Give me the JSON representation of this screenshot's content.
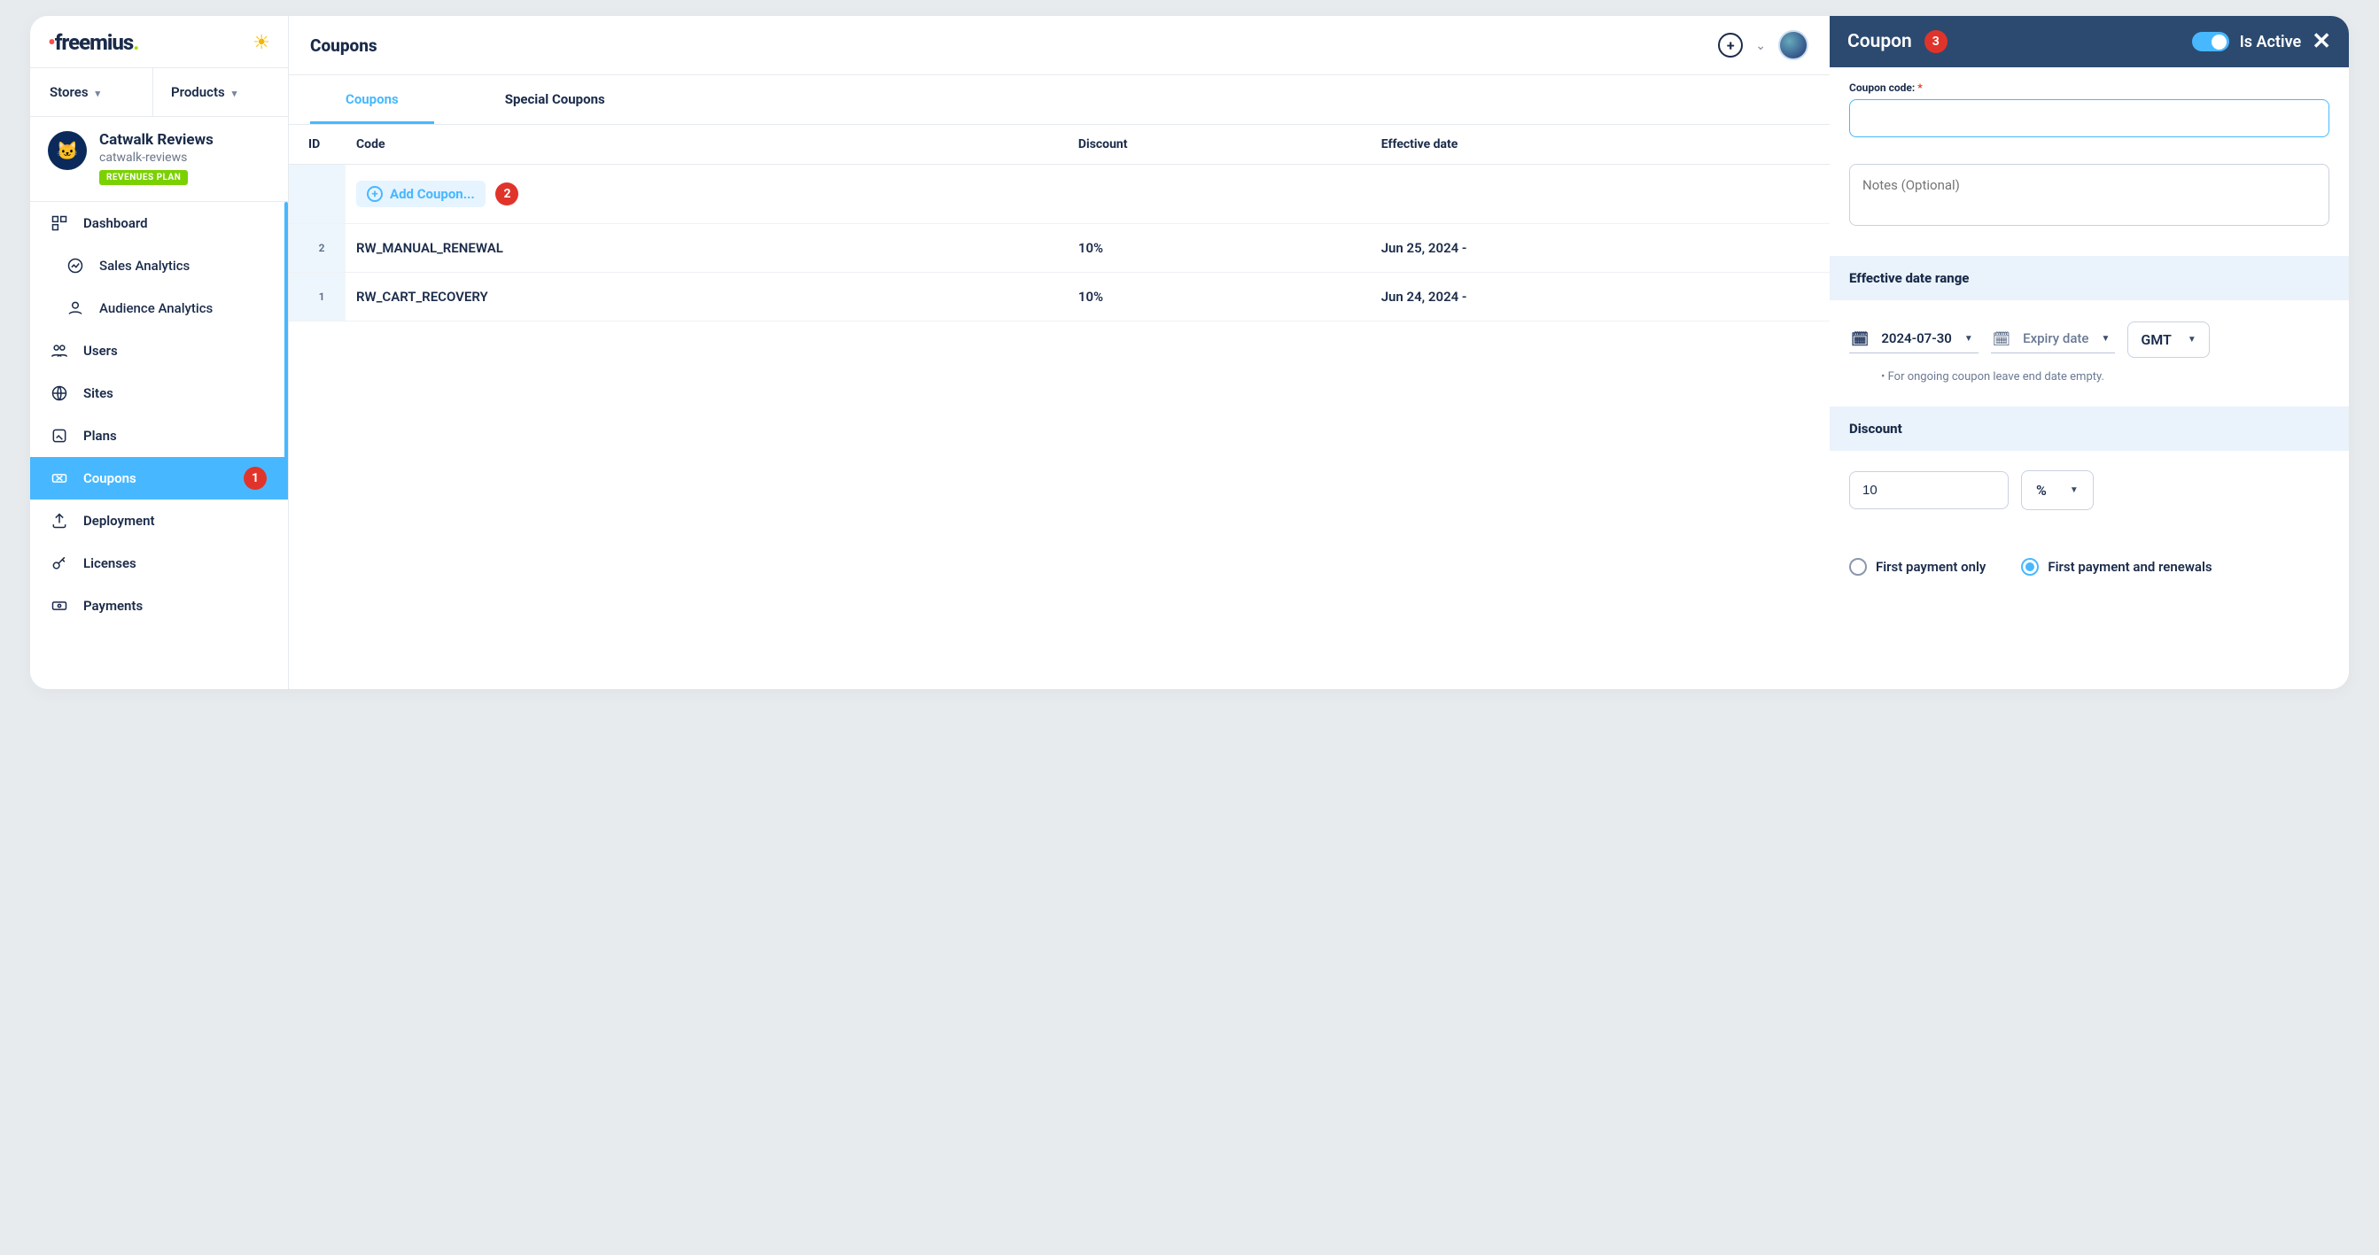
{
  "brand": "freemius",
  "header": {
    "stores_label": "Stores",
    "products_label": "Products"
  },
  "product": {
    "name": "Catwalk Reviews",
    "slug": "catwalk-reviews",
    "badge": "REVENUES PLAN"
  },
  "nav": {
    "dashboard": "Dashboard",
    "sales": "Sales Analytics",
    "audience": "Audience Analytics",
    "users": "Users",
    "sites": "Sites",
    "plans": "Plans",
    "coupons": "Coupons",
    "deployment": "Deployment",
    "licenses": "Licenses",
    "payments": "Payments"
  },
  "annotations": {
    "one": "1",
    "two": "2",
    "three": "3"
  },
  "main": {
    "title": "Coupons",
    "tabs": {
      "coupons": "Coupons",
      "special": "Special Coupons"
    },
    "columns": {
      "id": "ID",
      "code": "Code",
      "discount": "Discount",
      "date": "Effective date"
    },
    "add_label": "Add Coupon...",
    "rows": [
      {
        "id": "2",
        "code": "RW_MANUAL_RENEWAL",
        "discount": "10%",
        "date": "Jun 25, 2024 -"
      },
      {
        "id": "1",
        "code": "RW_CART_RECOVERY",
        "discount": "10%",
        "date": "Jun 24, 2024 -"
      }
    ]
  },
  "panel": {
    "title": "Coupon",
    "active_label": "Is Active",
    "code_label": "Coupon code:",
    "code_value": "",
    "notes_placeholder": "Notes (Optional)",
    "date_section": "Effective date range",
    "start_date": "2024-07-30",
    "end_placeholder": "Expiry date",
    "tz": "GMT",
    "hint": "• For ongoing coupon leave end date empty.",
    "discount_section": "Discount",
    "discount_value": "10",
    "discount_unit": "%",
    "radio_first": "First payment only",
    "radio_renewals": "First payment and renewals"
  }
}
